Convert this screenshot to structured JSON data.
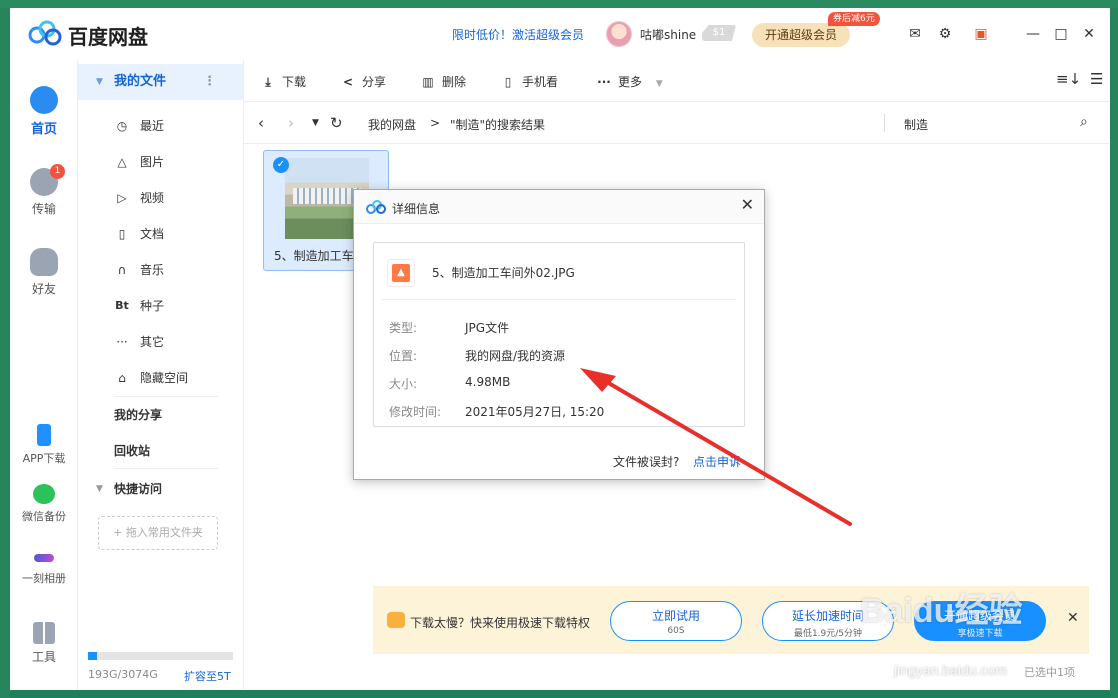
{
  "app": {
    "title": "百度网盘",
    "promo": "限时低价！激活超级会员",
    "username": "咕嘟shine",
    "vip_level": "$1",
    "open_vip": "开通超级会员",
    "coupon": "券后减6元"
  },
  "leftnav": {
    "home": "首页",
    "transfer": "传输",
    "transfer_badge": "1",
    "friends": "好友",
    "app_download": "APP下载",
    "wechat_backup": "微信备份",
    "album": "一刻相册",
    "tools": "工具"
  },
  "sidebar": {
    "my_files": "我的文件",
    "items": [
      {
        "label": "最近",
        "icon": "clock-icon"
      },
      {
        "label": "图片",
        "icon": "image-icon"
      },
      {
        "label": "视频",
        "icon": "play-icon"
      },
      {
        "label": "文档",
        "icon": "document-icon"
      },
      {
        "label": "音乐",
        "icon": "headphones-icon"
      },
      {
        "label": "种子",
        "icon": "bt-icon"
      },
      {
        "label": "其它",
        "icon": "more-icon"
      },
      {
        "label": "隐藏空间",
        "icon": "lock-icon"
      }
    ],
    "my_share": "我的分享",
    "recycle": "回收站",
    "quick_access": "快捷访问",
    "drop_folder": "+ 拖入常用文件夹",
    "storage_text": "193G/3074G",
    "storage_fraction": 0.063,
    "expand": "扩容至5T"
  },
  "toolbar": {
    "download": "下载",
    "share": "分享",
    "delete": "删除",
    "mobile_view": "手机看",
    "more": "更多"
  },
  "breadcrumb": {
    "root": "我的网盘",
    "sep": ">",
    "current": "\"制造\"的搜索结果",
    "search_term": "制造"
  },
  "file_tile": {
    "name": "5、制造加工车间外02.JPG",
    "checked": true
  },
  "dialog": {
    "title": "详细信息",
    "file_name": "5、制造加工车间外02.JPG",
    "props": [
      {
        "key": "类型:",
        "value": "JPG文件"
      },
      {
        "key": "位置:",
        "value": "我的网盘/我的资源"
      },
      {
        "key": "大小:",
        "value": "4.98MB"
      },
      {
        "key": "修改时间:",
        "value": "2021年05月27日, 15:20"
      }
    ],
    "footer_q": "文件被误封?",
    "footer_link": "点击申诉"
  },
  "banner": {
    "text": "下载太慢？快来使用极速下载特权",
    "btn1_main": "立即试用",
    "btn1_sub": "60S",
    "btn2_main": "延长加速时间",
    "btn2_sub": "最低1.9元/5分钟",
    "btn3_main": "开通超级会员",
    "btn3_sub": "享极速下载"
  },
  "status": {
    "selected": "已选中1项"
  },
  "watermark": {
    "brand": "Baidu经验",
    "url": "jingyan.baidu.com"
  },
  "colors": {
    "accent": "#1565d8",
    "arrow": "#e8302a",
    "banner_bg": "#fdf3d9"
  }
}
